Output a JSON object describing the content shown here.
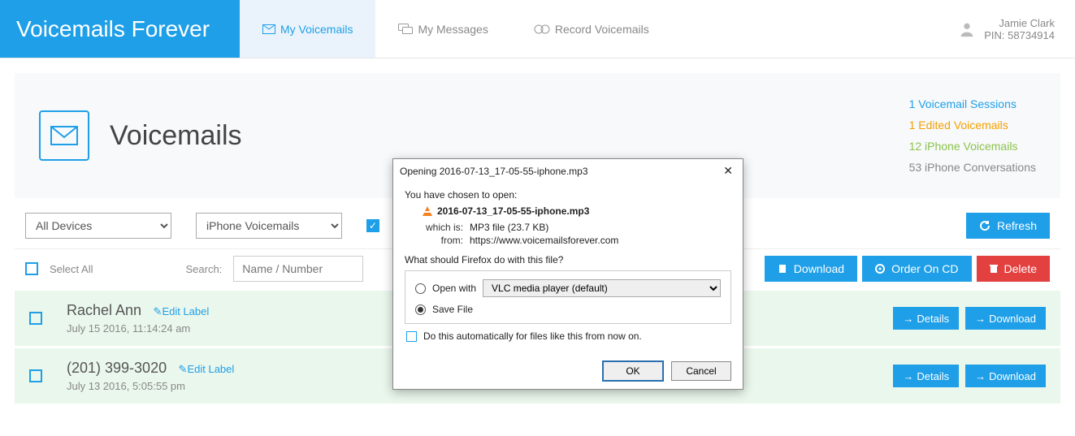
{
  "brand": "Voicemails Forever",
  "nav": {
    "voicemails": "My Voicemails",
    "messages": "My Messages",
    "record": "Record Voicemails"
  },
  "user": {
    "name": "Jamie Clark",
    "pin_label": "PIN: 58734914"
  },
  "page": {
    "title": "Voicemails"
  },
  "stats": {
    "sessions": "1 Voicemail Sessions",
    "edited": "1 Edited Voicemails",
    "iphone_vm": "12 iPhone Voicemails",
    "iphone_conv": "53 iPhone Conversations"
  },
  "filters": {
    "device": "All Devices",
    "type": "iPhone Voicemails",
    "refresh": "Refresh"
  },
  "listbar": {
    "select_all": "Select All",
    "search_label": "Search:",
    "search_placeholder": "Name / Number",
    "download": "Download",
    "order_cd": "Order On CD",
    "delete": "Delete"
  },
  "row_labels": {
    "edit": "Edit Label",
    "details": "Details",
    "download": "Download"
  },
  "rows": [
    {
      "title": "Rachel Ann",
      "date": "July 15 2016, 11:14:24 am"
    },
    {
      "title": "(201) 399-3020",
      "date": "July 13 2016, 5:05:55 pm"
    }
  ],
  "dialog": {
    "title": "Opening 2016-07-13_17-05-55-iphone.mp3",
    "chosen": "You have chosen to open:",
    "filename": "2016-07-13_17-05-55-iphone.mp3",
    "which_k": "which is:",
    "which_v": "MP3 file (23.7 KB)",
    "from_k": "from:",
    "from_v": "https://www.voicemailsforever.com",
    "question": "What should Firefox do with this file?",
    "open_with": "Open with",
    "open_with_app": "VLC media player (default)",
    "save_file": "Save File",
    "auto": "Do this automatically for files like this from now on.",
    "ok": "OK",
    "cancel": "Cancel"
  }
}
